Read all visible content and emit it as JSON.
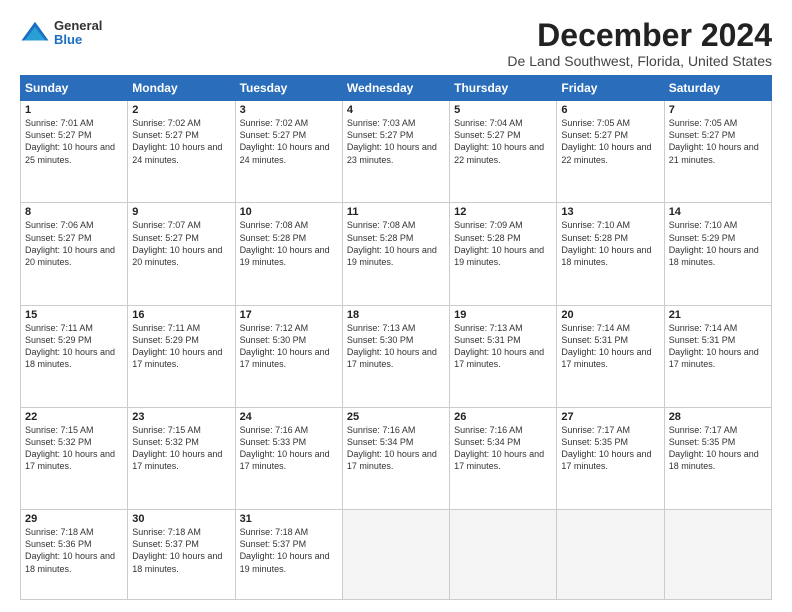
{
  "logo": {
    "general": "General",
    "blue": "Blue"
  },
  "title": "December 2024",
  "subtitle": "De Land Southwest, Florida, United States",
  "days_of_week": [
    "Sunday",
    "Monday",
    "Tuesday",
    "Wednesday",
    "Thursday",
    "Friday",
    "Saturday"
  ],
  "weeks": [
    [
      {
        "day": 1,
        "sunrise": "7:01 AM",
        "sunset": "5:27 PM",
        "daylight": "10 hours and 25 minutes."
      },
      {
        "day": 2,
        "sunrise": "7:02 AM",
        "sunset": "5:27 PM",
        "daylight": "10 hours and 24 minutes."
      },
      {
        "day": 3,
        "sunrise": "7:02 AM",
        "sunset": "5:27 PM",
        "daylight": "10 hours and 24 minutes."
      },
      {
        "day": 4,
        "sunrise": "7:03 AM",
        "sunset": "5:27 PM",
        "daylight": "10 hours and 23 minutes."
      },
      {
        "day": 5,
        "sunrise": "7:04 AM",
        "sunset": "5:27 PM",
        "daylight": "10 hours and 22 minutes."
      },
      {
        "day": 6,
        "sunrise": "7:05 AM",
        "sunset": "5:27 PM",
        "daylight": "10 hours and 22 minutes."
      },
      {
        "day": 7,
        "sunrise": "7:05 AM",
        "sunset": "5:27 PM",
        "daylight": "10 hours and 21 minutes."
      }
    ],
    [
      {
        "day": 8,
        "sunrise": "7:06 AM",
        "sunset": "5:27 PM",
        "daylight": "10 hours and 20 minutes."
      },
      {
        "day": 9,
        "sunrise": "7:07 AM",
        "sunset": "5:27 PM",
        "daylight": "10 hours and 20 minutes."
      },
      {
        "day": 10,
        "sunrise": "7:08 AM",
        "sunset": "5:28 PM",
        "daylight": "10 hours and 19 minutes."
      },
      {
        "day": 11,
        "sunrise": "7:08 AM",
        "sunset": "5:28 PM",
        "daylight": "10 hours and 19 minutes."
      },
      {
        "day": 12,
        "sunrise": "7:09 AM",
        "sunset": "5:28 PM",
        "daylight": "10 hours and 19 minutes."
      },
      {
        "day": 13,
        "sunrise": "7:10 AM",
        "sunset": "5:28 PM",
        "daylight": "10 hours and 18 minutes."
      },
      {
        "day": 14,
        "sunrise": "7:10 AM",
        "sunset": "5:29 PM",
        "daylight": "10 hours and 18 minutes."
      }
    ],
    [
      {
        "day": 15,
        "sunrise": "7:11 AM",
        "sunset": "5:29 PM",
        "daylight": "10 hours and 18 minutes."
      },
      {
        "day": 16,
        "sunrise": "7:11 AM",
        "sunset": "5:29 PM",
        "daylight": "10 hours and 17 minutes."
      },
      {
        "day": 17,
        "sunrise": "7:12 AM",
        "sunset": "5:30 PM",
        "daylight": "10 hours and 17 minutes."
      },
      {
        "day": 18,
        "sunrise": "7:13 AM",
        "sunset": "5:30 PM",
        "daylight": "10 hours and 17 minutes."
      },
      {
        "day": 19,
        "sunrise": "7:13 AM",
        "sunset": "5:31 PM",
        "daylight": "10 hours and 17 minutes."
      },
      {
        "day": 20,
        "sunrise": "7:14 AM",
        "sunset": "5:31 PM",
        "daylight": "10 hours and 17 minutes."
      },
      {
        "day": 21,
        "sunrise": "7:14 AM",
        "sunset": "5:31 PM",
        "daylight": "10 hours and 17 minutes."
      }
    ],
    [
      {
        "day": 22,
        "sunrise": "7:15 AM",
        "sunset": "5:32 PM",
        "daylight": "10 hours and 17 minutes."
      },
      {
        "day": 23,
        "sunrise": "7:15 AM",
        "sunset": "5:32 PM",
        "daylight": "10 hours and 17 minutes."
      },
      {
        "day": 24,
        "sunrise": "7:16 AM",
        "sunset": "5:33 PM",
        "daylight": "10 hours and 17 minutes."
      },
      {
        "day": 25,
        "sunrise": "7:16 AM",
        "sunset": "5:34 PM",
        "daylight": "10 hours and 17 minutes."
      },
      {
        "day": 26,
        "sunrise": "7:16 AM",
        "sunset": "5:34 PM",
        "daylight": "10 hours and 17 minutes."
      },
      {
        "day": 27,
        "sunrise": "7:17 AM",
        "sunset": "5:35 PM",
        "daylight": "10 hours and 17 minutes."
      },
      {
        "day": 28,
        "sunrise": "7:17 AM",
        "sunset": "5:35 PM",
        "daylight": "10 hours and 18 minutes."
      }
    ],
    [
      {
        "day": 29,
        "sunrise": "7:18 AM",
        "sunset": "5:36 PM",
        "daylight": "10 hours and 18 minutes."
      },
      {
        "day": 30,
        "sunrise": "7:18 AM",
        "sunset": "5:37 PM",
        "daylight": "10 hours and 18 minutes."
      },
      {
        "day": 31,
        "sunrise": "7:18 AM",
        "sunset": "5:37 PM",
        "daylight": "10 hours and 19 minutes."
      },
      null,
      null,
      null,
      null
    ]
  ]
}
